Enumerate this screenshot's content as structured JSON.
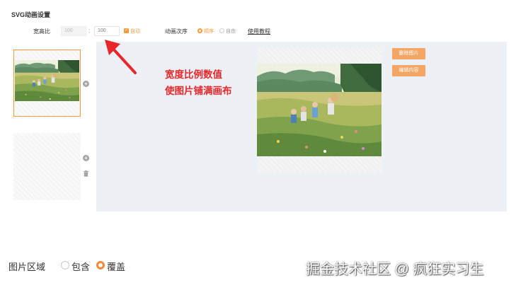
{
  "page": {
    "title": "SVG动画设置"
  },
  "ratio": {
    "label": "宽高比",
    "width_value": "100",
    "separator": ":",
    "height_value": "100",
    "auto_checked": true,
    "auto_label": "自动"
  },
  "animation_order": {
    "label": "动画次序",
    "options": [
      "顺序",
      "自由"
    ],
    "selected": "顺序",
    "tutorial_link": "使用教程"
  },
  "frames": {
    "count": 2,
    "selected_index": 0
  },
  "actions": {
    "delete_image": "删除图片",
    "edit_content": "编辑内容"
  },
  "annotation": {
    "line1": "宽度比例数值",
    "line2": "使图片铺满画布"
  },
  "image_area": {
    "label": "图片区域",
    "options": [
      "包含",
      "覆盖"
    ],
    "selected": "覆盖"
  },
  "watermark": "掘金技术社区 @ 疯狂实习生",
  "colors": {
    "accent": "#f29b3a",
    "button": "#f5a665",
    "annotation": "#e8262b",
    "canvas_bg": "#edf1f5"
  },
  "icons": [
    "plus-circle-icon",
    "trash-icon",
    "checkmark-icon"
  ]
}
